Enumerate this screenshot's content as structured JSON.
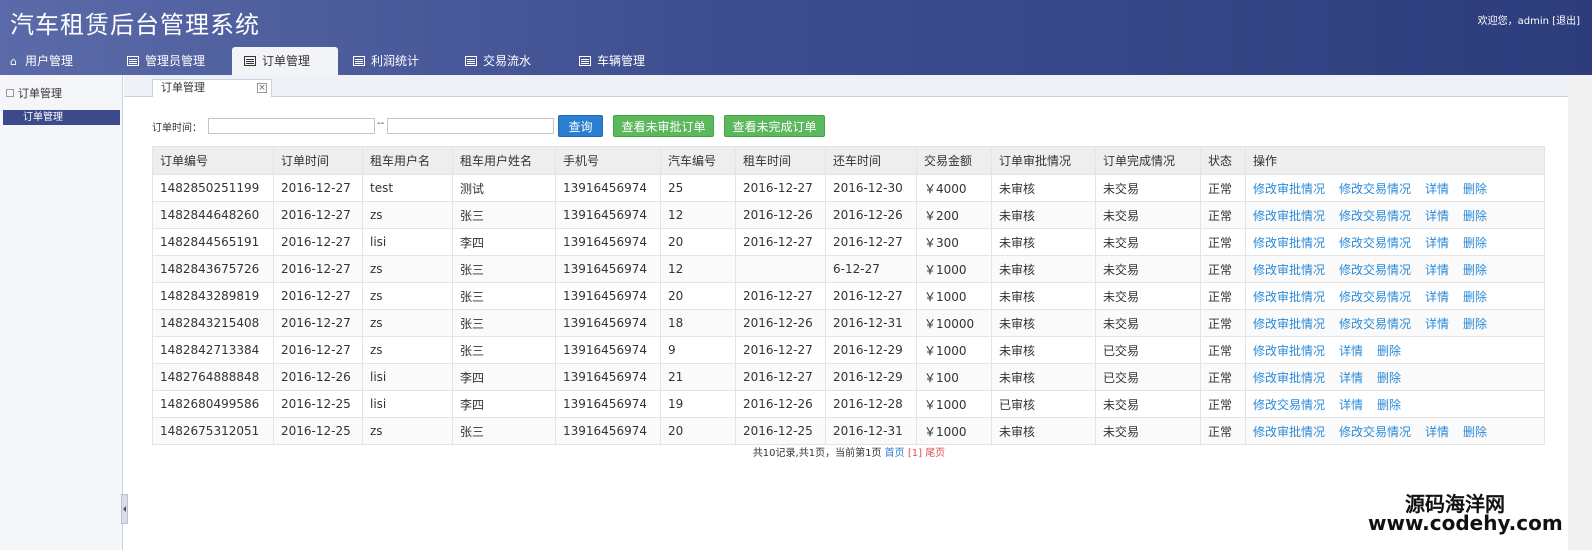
{
  "app": {
    "title": "汽车租赁后台管理系统",
    "welcome": "欢迎您，admin [退出]"
  },
  "nav": {
    "tabs": [
      {
        "label": "用户管理",
        "icon": "home-icon"
      },
      {
        "label": "管理员管理",
        "icon": "list-icon"
      },
      {
        "label": "订单管理",
        "icon": "list-icon",
        "active": true
      },
      {
        "label": "利润统计",
        "icon": "list-icon"
      },
      {
        "label": "交易流水",
        "icon": "list-icon"
      },
      {
        "label": "车辆管理",
        "icon": "list-icon"
      }
    ]
  },
  "sidebar": {
    "title": "订单管理",
    "items": [
      {
        "label": "订单管理",
        "selected": true
      }
    ]
  },
  "content_tab": {
    "label": "订单管理",
    "close": "×"
  },
  "filter": {
    "label": "订单时间：",
    "start_value": "",
    "separator": "--",
    "end_value": "",
    "buttons": {
      "query": "查询",
      "unapproved": "查看未审批订单",
      "unfinished": "查看未完成订单"
    }
  },
  "table": {
    "headers": [
      "订单编号",
      "订单时间",
      "租车用户名",
      "租车用户姓名",
      "手机号",
      "汽车编号",
      "租车时间",
      "还车时间",
      "交易金额",
      "订单审批情况",
      "订单完成情况",
      "状态",
      "操作"
    ],
    "rows": [
      [
        "1482850251199",
        "2016-12-27",
        "test",
        "测试",
        "13916456974",
        "25",
        "2016-12-27",
        "2016-12-30",
        "￥4000",
        "未审核",
        "未交易",
        "正常"
      ],
      [
        "1482844648260",
        "2016-12-27",
        "zs",
        "张三",
        "13916456974",
        "12",
        "2016-12-26",
        "2016-12-26",
        "￥200",
        "未审核",
        "未交易",
        "正常"
      ],
      [
        "1482844565191",
        "2016-12-27",
        "lisi",
        "李四",
        "13916456974",
        "20",
        "2016-12-27",
        "2016-12-27",
        "￥300",
        "未审核",
        "未交易",
        "正常"
      ],
      [
        "1482843675726",
        "2016-12-27",
        "zs",
        "张三",
        "13916456974",
        "12",
        "",
        "6-12-27",
        "￥1000",
        "未审核",
        "未交易",
        "正常"
      ],
      [
        "1482843289819",
        "2016-12-27",
        "zs",
        "张三",
        "13916456974",
        "20",
        "2016-12-27",
        "2016-12-27",
        "￥1000",
        "未审核",
        "未交易",
        "正常"
      ],
      [
        "1482843215408",
        "2016-12-27",
        "zs",
        "张三",
        "13916456974",
        "18",
        "2016-12-26",
        "2016-12-31",
        "￥10000",
        "未审核",
        "未交易",
        "正常"
      ],
      [
        "1482842713384",
        "2016-12-27",
        "zs",
        "张三",
        "13916456974",
        "9",
        "2016-12-27",
        "2016-12-29",
        "￥1000",
        "未审核",
        "已交易",
        "正常"
      ],
      [
        "1482764888848",
        "2016-12-26",
        "lisi",
        "李四",
        "13916456974",
        "21",
        "2016-12-27",
        "2016-12-29",
        "￥100",
        "未审核",
        "已交易",
        "正常"
      ],
      [
        "1482680499586",
        "2016-12-25",
        "lisi",
        "李四",
        "13916456974",
        "19",
        "2016-12-26",
        "2016-12-28",
        "￥1000",
        "已审核",
        "未交易",
        "正常"
      ],
      [
        "1482675312051",
        "2016-12-25",
        "zs",
        "张三",
        "13916456974",
        "20",
        "2016-12-25",
        "2016-12-31",
        "￥1000",
        "未审核",
        "未交易",
        "正常"
      ]
    ],
    "actions": [
      [
        "修改审批情况",
        "修改交易情况",
        "详情",
        "删除"
      ],
      [
        "修改审批情况",
        "修改交易情况",
        "详情",
        "删除"
      ],
      [
        "修改审批情况",
        "修改交易情况",
        "详情",
        "删除"
      ],
      [
        "修改审批情况",
        "修改交易情况",
        "详情",
        "删除"
      ],
      [
        "修改审批情况",
        "修改交易情况",
        "详情",
        "删除"
      ],
      [
        "修改审批情况",
        "修改交易情况",
        "详情",
        "删除"
      ],
      [
        "修改审批情况",
        "详情",
        "删除"
      ],
      [
        "修改审批情况",
        "详情",
        "删除"
      ],
      [
        "修改交易情况",
        "详情",
        "删除"
      ],
      [
        "修改审批情况",
        "修改交易情况",
        "详情",
        "删除"
      ]
    ]
  },
  "pager": {
    "summary": "共10记录,共1页，当前第1页",
    "first": "首页",
    "current": "[1]",
    "last": "尾页"
  },
  "watermark": {
    "line1": "源码海洋网",
    "line2": "www.codehy.com"
  },
  "colors": {
    "header": "#3d4d8e",
    "link": "#2a8ad8",
    "query_button": "#2a7fd0",
    "filter_button": "#5cb85c"
  }
}
